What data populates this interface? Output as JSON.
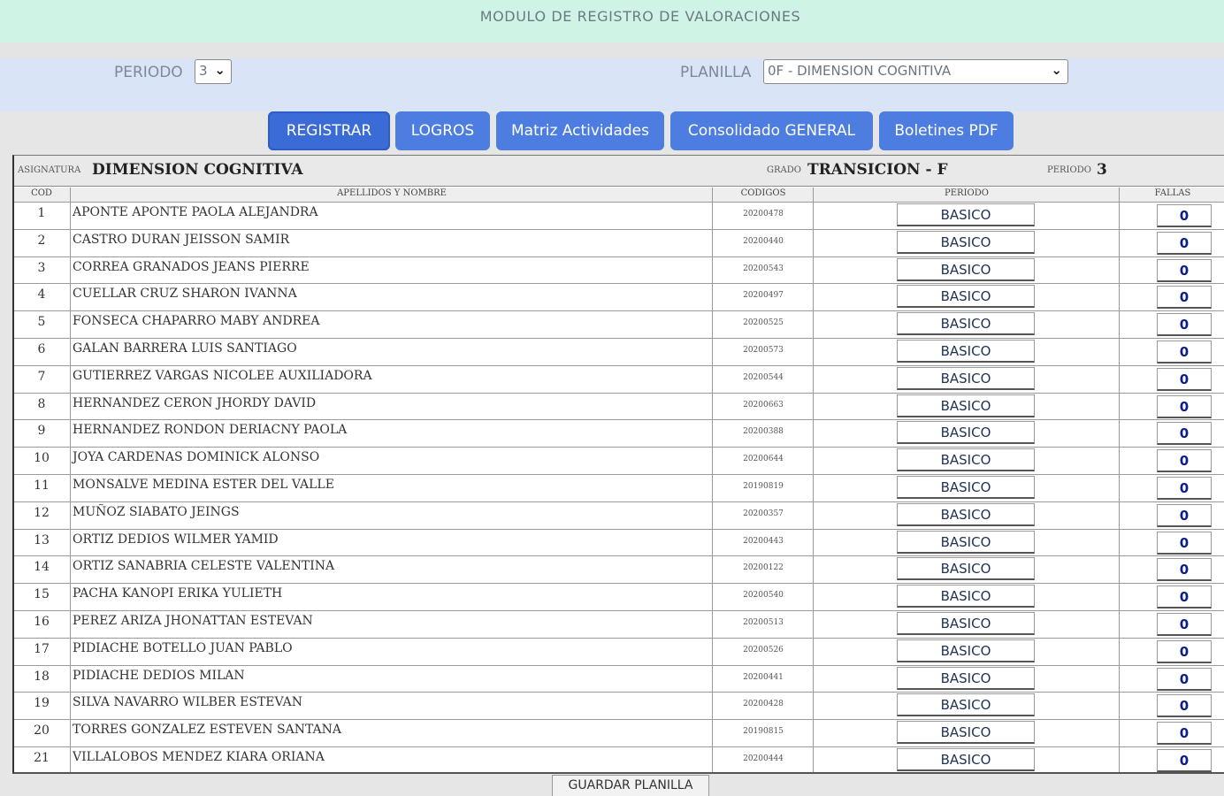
{
  "header": {
    "title": "MODULO DE REGISTRO DE VALORACIONES"
  },
  "filters": {
    "period_label": "PERIODO",
    "period_value": "3",
    "sheet_label": "PLANILLA",
    "sheet_value": "0F - DIMENSION COGNITIVA"
  },
  "toolbar": {
    "register": "REGISTRAR",
    "achievements": "LOGROS",
    "activity_matrix": "Matriz Actividades",
    "general_summary": "Consolidado GENERAL",
    "pdf_reports": "Boletines PDF"
  },
  "info": {
    "subject_label": "ASIGNATURA",
    "subject": "DIMENSION COGNITIVA",
    "grade_label": "GRADO",
    "grade": "TRANSICION - F",
    "period_label": "PERIODO",
    "period": "3"
  },
  "columns": {
    "cod": "COD",
    "name": "APELLIDOS Y NOMBRE",
    "code": "CODIGOS",
    "period": "PERIODO",
    "absences": "FALLAS"
  },
  "students": [
    {
      "n": "1",
      "name": "APONTE APONTE PAOLA ALEJANDRA",
      "code": "20200478",
      "grade": "BASICO",
      "absences": "0"
    },
    {
      "n": "2",
      "name": "CASTRO DURAN JEISSON SAMIR",
      "code": "20200440",
      "grade": "BASICO",
      "absences": "0"
    },
    {
      "n": "3",
      "name": "CORREA GRANADOS JEANS PIERRE",
      "code": "20200543",
      "grade": "BASICO",
      "absences": "0"
    },
    {
      "n": "4",
      "name": "CUELLAR CRUZ SHARON IVANNA",
      "code": "20200497",
      "grade": "BASICO",
      "absences": "0"
    },
    {
      "n": "5",
      "name": "FONSECA CHAPARRO MABY ANDREA",
      "code": "20200525",
      "grade": "BASICO",
      "absences": "0"
    },
    {
      "n": "6",
      "name": "GALAN BARRERA LUIS SANTIAGO",
      "code": "20200573",
      "grade": "BASICO",
      "absences": "0"
    },
    {
      "n": "7",
      "name": "GUTIERREZ VARGAS NICOLEE AUXILIADORA",
      "code": "20200544",
      "grade": "BASICO",
      "absences": "0"
    },
    {
      "n": "8",
      "name": "HERNANDEZ CERON JHORDY DAVID",
      "code": "20200663",
      "grade": "BASICO",
      "absences": "0"
    },
    {
      "n": "9",
      "name": "HERNANDEZ RONDON DERIACNY PAOLA",
      "code": "20200388",
      "grade": "BASICO",
      "absences": "0"
    },
    {
      "n": "10",
      "name": "JOYA CARDENAS DOMINICK ALONSO",
      "code": "20200644",
      "grade": "BASICO",
      "absences": "0"
    },
    {
      "n": "11",
      "name": "MONSALVE MEDINA ESTER DEL VALLE",
      "code": "20190819",
      "grade": "BASICO",
      "absences": "0"
    },
    {
      "n": "12",
      "name": "MUÑOZ SIABATO JEINGS",
      "code": "20200357",
      "grade": "BASICO",
      "absences": "0"
    },
    {
      "n": "13",
      "name": "ORTIZ DEDIOS WILMER YAMID",
      "code": "20200443",
      "grade": "BASICO",
      "absences": "0"
    },
    {
      "n": "14",
      "name": "ORTIZ SANABRIA CELESTE VALENTINA",
      "code": "20200122",
      "grade": "BASICO",
      "absences": "0"
    },
    {
      "n": "15",
      "name": "PACHA KANOPI ERIKA YULIETH",
      "code": "20200540",
      "grade": "BASICO",
      "absences": "0"
    },
    {
      "n": "16",
      "name": "PEREZ ARIZA JHONATTAN ESTEVAN",
      "code": "20200513",
      "grade": "BASICO",
      "absences": "0"
    },
    {
      "n": "17",
      "name": "PIDIACHE BOTELLO JUAN PABLO",
      "code": "20200526",
      "grade": "BASICO",
      "absences": "0"
    },
    {
      "n": "18",
      "name": "PIDIACHE DEDIOS MILAN",
      "code": "20200441",
      "grade": "BASICO",
      "absences": "0"
    },
    {
      "n": "19",
      "name": "SILVA NAVARRO WILBER ESTEVAN",
      "code": "20200428",
      "grade": "BASICO",
      "absences": "0"
    },
    {
      "n": "20",
      "name": "TORRES GONZALEZ ESTEVEN SANTANA",
      "code": "20190815",
      "grade": "BASICO",
      "absences": "0"
    },
    {
      "n": "21",
      "name": "VILLALOBOS MENDEZ KIARA ORIANA",
      "code": "20200444",
      "grade": "BASICO",
      "absences": "0"
    }
  ],
  "footer": {
    "save": "GUARDAR PLANILLA"
  }
}
